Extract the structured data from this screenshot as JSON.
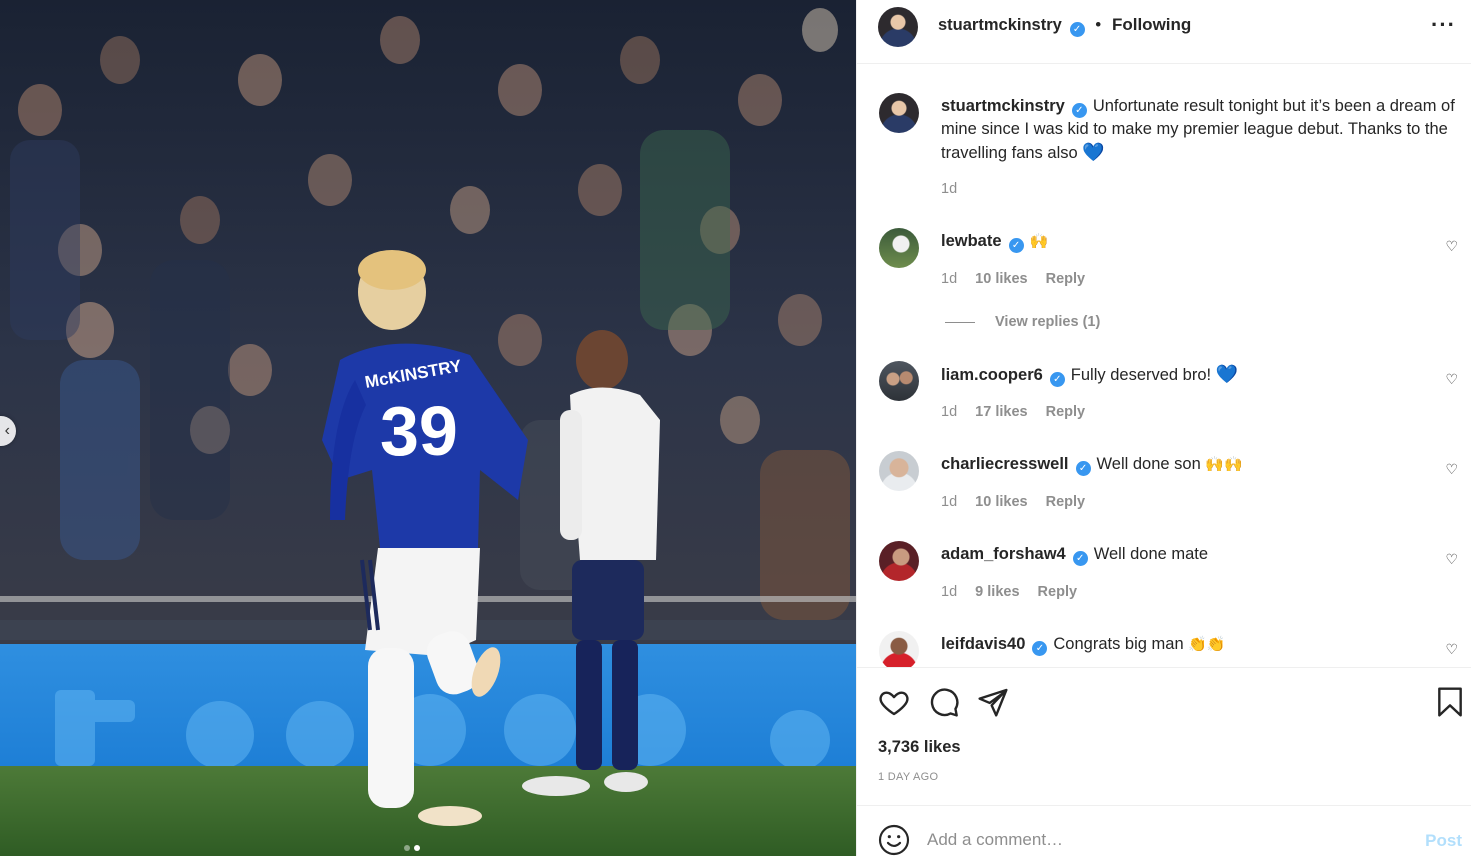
{
  "photo": {
    "jersey_name": "McKINSTRY",
    "jersey_number": "39",
    "carousel": {
      "dots": 2,
      "active": 2
    }
  },
  "header": {
    "username": "stuartmckinstry",
    "separator": "•",
    "follow_status": "Following",
    "more_icon": "more-dots-icon"
  },
  "caption": {
    "username": "stuartmckinstry",
    "text": "Unfortunate result tonight but it’s been a dream of mine since I was kid to make my premier league debut. Thanks to the travelling fans also",
    "emoji": "💙",
    "time": "1d"
  },
  "comments": [
    {
      "username": "lewbate",
      "text": "",
      "emoji": "🙌",
      "time": "1d",
      "likes": "10 likes",
      "reply": "Reply",
      "view_replies": "View replies (1)"
    },
    {
      "username": "liam.cooper6",
      "text": "Fully deserved bro!",
      "emoji": "💙",
      "time": "1d",
      "likes": "17 likes",
      "reply": "Reply"
    },
    {
      "username": "charliecresswell",
      "text": "Well done son",
      "emoji": "🙌🙌",
      "time": "1d",
      "likes": "10 likes",
      "reply": "Reply"
    },
    {
      "username": "adam_forshaw4",
      "text": "Well done mate",
      "emoji": "",
      "time": "1d",
      "likes": "9 likes",
      "reply": "Reply"
    },
    {
      "username": "leifdavis40",
      "text": "Congrats big man",
      "emoji": "👏👏",
      "time": "1d",
      "likes": "",
      "reply": ""
    }
  ],
  "actions": {
    "likes": "3,736 likes",
    "posted": "1 DAY AGO"
  },
  "add_comment": {
    "placeholder": "Add a comment…",
    "post_label": "Post"
  },
  "colors": {
    "verified": "#3897f0",
    "post_disabled": "#b2dffc",
    "kit_blue": "#1d39a8"
  }
}
